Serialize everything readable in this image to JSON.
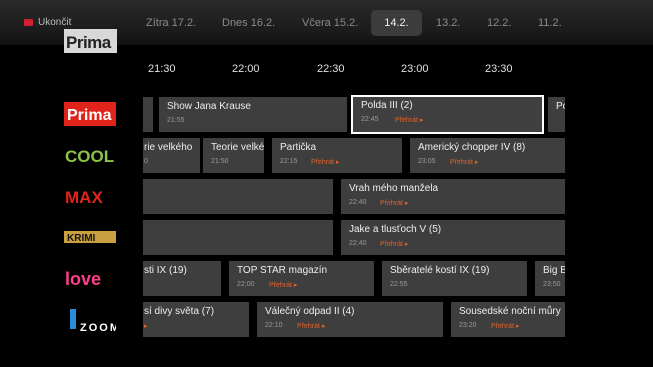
{
  "header": {
    "exit_label": "Ukončit",
    "channel_logo": "Prima",
    "dates": [
      {
        "label": "Zítra 17.2."
      },
      {
        "label": "Dnes 16.2."
      },
      {
        "label": "Včera 15.2."
      },
      {
        "label": "14.2."
      },
      {
        "label": "13.2."
      },
      {
        "label": "12.2."
      },
      {
        "label": "11.2."
      }
    ]
  },
  "timeline": [
    "21:30",
    "22:00",
    "22:30",
    "23:00",
    "23:30"
  ],
  "play_label": "Přehrát ▸",
  "channels": [
    {
      "name": "Prima",
      "programs": [
        {
          "title": "",
          "time": ""
        },
        {
          "title": "Show Jana Krause",
          "time": "21:55"
        },
        {
          "title": "Polda III (2)",
          "time": "22:45",
          "play": "Přehrát ▸"
        },
        {
          "title": "Po",
          "time": ""
        }
      ]
    },
    {
      "name": "COOL",
      "programs": [
        {
          "title": "rie velkého",
          "time": "0"
        },
        {
          "title": "Teorie velké",
          "time": "21:50"
        },
        {
          "title": "Partička",
          "time": "22:15",
          "play": "Přehrát ▸"
        },
        {
          "title": "Americký chopper IV (8)",
          "time": "23:05",
          "play": "Přehrát ▸"
        }
      ]
    },
    {
      "name": "MAX",
      "programs": [
        {
          "title": "",
          "time": ""
        },
        {
          "title": "Vrah mého manžela",
          "time": "22:40",
          "play": "Přehrát ▸"
        }
      ]
    },
    {
      "name": "KRIMI",
      "programs": [
        {
          "title": "",
          "time": ""
        },
        {
          "title": "Jake a tlusťoch V (5)",
          "time": "22:40",
          "play": "Přehrát ▸"
        }
      ]
    },
    {
      "name": "love",
      "programs": [
        {
          "title": "sti IX (19)",
          "time": ""
        },
        {
          "title": "TOP STAR magazín",
          "time": "22:00",
          "play": "Přehrát ▸"
        },
        {
          "title": "Sběratelé kostí IX (19)",
          "time": "22:55"
        },
        {
          "title": "Big B",
          "time": "23:50"
        }
      ]
    },
    {
      "name": "ZOOM",
      "programs": [
        {
          "title": "sí divy světa (7)",
          "time": "",
          "play": "▸"
        },
        {
          "title": "Válečný odpad II (4)",
          "time": "22:10",
          "play": "Přehrát ▸"
        },
        {
          "title": "Sousedské noční můry",
          "time": "23:20",
          "play": "Přehrát ▸"
        }
      ]
    }
  ],
  "colors": {
    "accent": "#e0622a",
    "exit_icon": "#d02030",
    "cell_bg": "#3e3e3e",
    "selected_border": "#ffffff"
  }
}
